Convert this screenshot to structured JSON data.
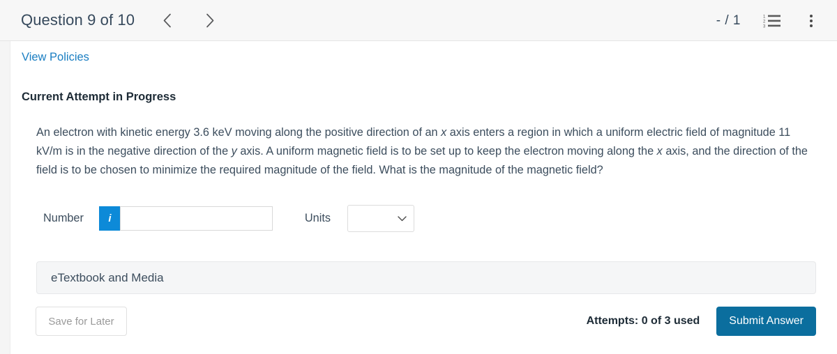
{
  "header": {
    "question_title": "Question 9 of 10",
    "prev_icon": "chevron-left-icon",
    "next_icon": "chevron-right-icon",
    "score": "- / 1",
    "list_icon": "numbered-list-icon",
    "menu_icon": "kebab-menu-icon"
  },
  "links": {
    "view_policies": "View Policies"
  },
  "attempt": {
    "heading": "Current Attempt in Progress"
  },
  "question": {
    "part1": "An electron with kinetic energy 3.6 keV moving along the positive direction of an ",
    "var_x1": "x",
    "part2": " axis enters a region in which a uniform electric field of magnitude 11 kV/m is in the negative direction of the ",
    "var_y": "y",
    "part3": " axis. A uniform magnetic field is to be set up to keep the electron moving along the ",
    "var_x2": "x",
    "part4": " axis, and the direction of the field is to be chosen to minimize the required magnitude of the field. What is the magnitude of the magnetic field?"
  },
  "answer": {
    "number_label": "Number",
    "info_icon_glyph": "i",
    "number_value": "",
    "number_placeholder": "",
    "units_label": "Units",
    "units_value": "",
    "units_chevron_icon": "chevron-down-icon"
  },
  "etextbook": {
    "label": "eTextbook and Media"
  },
  "footer": {
    "save_label": "Save for Later",
    "attempts": "Attempts: 0 of 3 used",
    "submit_label": "Submit Answer"
  },
  "colors": {
    "link_blue": "#1a7ec2",
    "info_blue": "#0d8ad8",
    "submit_blue": "#0b6e9e",
    "header_bg": "#f7f7f7",
    "etext_bg": "#f5f6f7",
    "text": "#3c4d5d"
  }
}
